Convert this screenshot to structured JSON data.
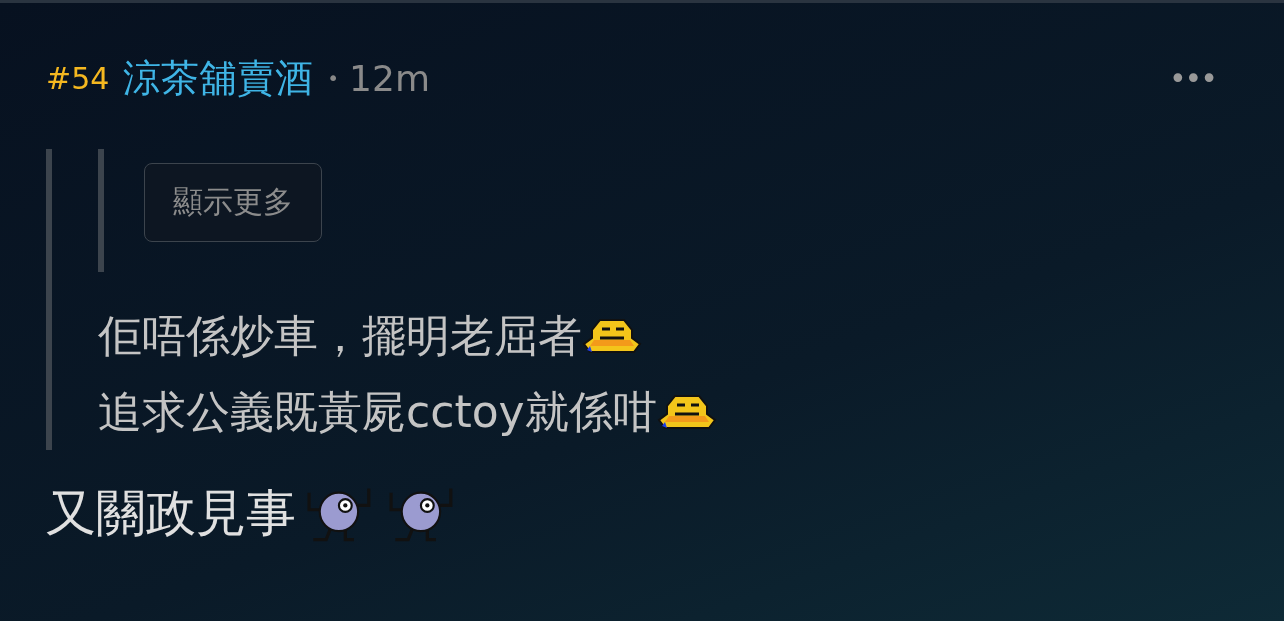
{
  "post": {
    "number": "#54",
    "author": "涼茶舖賣酒",
    "separator": "•",
    "time": "12m",
    "menu": "•••"
  },
  "quote": {
    "nested_quote": {
      "button": "顯示更多"
    },
    "lines": [
      [
        {
          "kind": "text",
          "text": "佢唔係炒車，擺明老屈者"
        },
        {
          "kind": "sweat"
        }
      ],
      [
        {
          "kind": "text",
          "text": "追求公義既黃屍cctoy就係咁"
        },
        {
          "kind": "sweat"
        }
      ]
    ]
  },
  "body": [
    {
      "kind": "text",
      "text": "又關政見事"
    },
    {
      "kind": "cheer"
    },
    {
      "kind": "cheer"
    }
  ]
}
